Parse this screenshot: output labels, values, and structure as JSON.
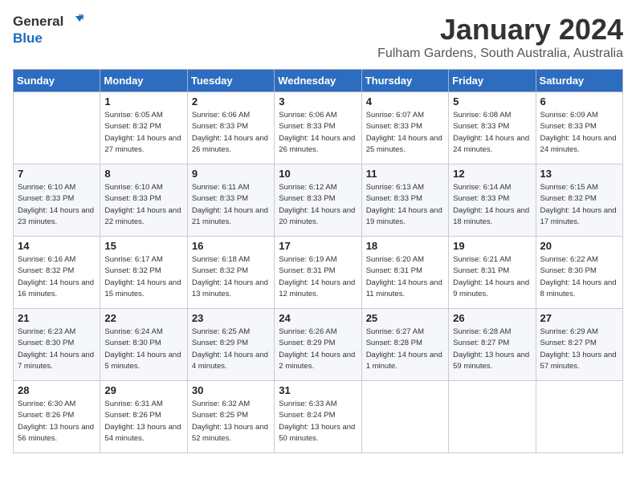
{
  "header": {
    "logo_general": "General",
    "logo_blue": "Blue",
    "month_title": "January 2024",
    "subtitle": "Fulham Gardens, South Australia, Australia"
  },
  "weekdays": [
    "Sunday",
    "Monday",
    "Tuesday",
    "Wednesday",
    "Thursday",
    "Friday",
    "Saturday"
  ],
  "weeks": [
    [
      {
        "day": "",
        "sunrise": "",
        "sunset": "",
        "daylight": ""
      },
      {
        "day": "1",
        "sunrise": "Sunrise: 6:05 AM",
        "sunset": "Sunset: 8:32 PM",
        "daylight": "Daylight: 14 hours and 27 minutes."
      },
      {
        "day": "2",
        "sunrise": "Sunrise: 6:06 AM",
        "sunset": "Sunset: 8:33 PM",
        "daylight": "Daylight: 14 hours and 26 minutes."
      },
      {
        "day": "3",
        "sunrise": "Sunrise: 6:06 AM",
        "sunset": "Sunset: 8:33 PM",
        "daylight": "Daylight: 14 hours and 26 minutes."
      },
      {
        "day": "4",
        "sunrise": "Sunrise: 6:07 AM",
        "sunset": "Sunset: 8:33 PM",
        "daylight": "Daylight: 14 hours and 25 minutes."
      },
      {
        "day": "5",
        "sunrise": "Sunrise: 6:08 AM",
        "sunset": "Sunset: 8:33 PM",
        "daylight": "Daylight: 14 hours and 24 minutes."
      },
      {
        "day": "6",
        "sunrise": "Sunrise: 6:09 AM",
        "sunset": "Sunset: 8:33 PM",
        "daylight": "Daylight: 14 hours and 24 minutes."
      }
    ],
    [
      {
        "day": "7",
        "sunrise": "Sunrise: 6:10 AM",
        "sunset": "Sunset: 8:33 PM",
        "daylight": "Daylight: 14 hours and 23 minutes."
      },
      {
        "day": "8",
        "sunrise": "Sunrise: 6:10 AM",
        "sunset": "Sunset: 8:33 PM",
        "daylight": "Daylight: 14 hours and 22 minutes."
      },
      {
        "day": "9",
        "sunrise": "Sunrise: 6:11 AM",
        "sunset": "Sunset: 8:33 PM",
        "daylight": "Daylight: 14 hours and 21 minutes."
      },
      {
        "day": "10",
        "sunrise": "Sunrise: 6:12 AM",
        "sunset": "Sunset: 8:33 PM",
        "daylight": "Daylight: 14 hours and 20 minutes."
      },
      {
        "day": "11",
        "sunrise": "Sunrise: 6:13 AM",
        "sunset": "Sunset: 8:33 PM",
        "daylight": "Daylight: 14 hours and 19 minutes."
      },
      {
        "day": "12",
        "sunrise": "Sunrise: 6:14 AM",
        "sunset": "Sunset: 8:33 PM",
        "daylight": "Daylight: 14 hours and 18 minutes."
      },
      {
        "day": "13",
        "sunrise": "Sunrise: 6:15 AM",
        "sunset": "Sunset: 8:32 PM",
        "daylight": "Daylight: 14 hours and 17 minutes."
      }
    ],
    [
      {
        "day": "14",
        "sunrise": "Sunrise: 6:16 AM",
        "sunset": "Sunset: 8:32 PM",
        "daylight": "Daylight: 14 hours and 16 minutes."
      },
      {
        "day": "15",
        "sunrise": "Sunrise: 6:17 AM",
        "sunset": "Sunset: 8:32 PM",
        "daylight": "Daylight: 14 hours and 15 minutes."
      },
      {
        "day": "16",
        "sunrise": "Sunrise: 6:18 AM",
        "sunset": "Sunset: 8:32 PM",
        "daylight": "Daylight: 14 hours and 13 minutes."
      },
      {
        "day": "17",
        "sunrise": "Sunrise: 6:19 AM",
        "sunset": "Sunset: 8:31 PM",
        "daylight": "Daylight: 14 hours and 12 minutes."
      },
      {
        "day": "18",
        "sunrise": "Sunrise: 6:20 AM",
        "sunset": "Sunset: 8:31 PM",
        "daylight": "Daylight: 14 hours and 11 minutes."
      },
      {
        "day": "19",
        "sunrise": "Sunrise: 6:21 AM",
        "sunset": "Sunset: 8:31 PM",
        "daylight": "Daylight: 14 hours and 9 minutes."
      },
      {
        "day": "20",
        "sunrise": "Sunrise: 6:22 AM",
        "sunset": "Sunset: 8:30 PM",
        "daylight": "Daylight: 14 hours and 8 minutes."
      }
    ],
    [
      {
        "day": "21",
        "sunrise": "Sunrise: 6:23 AM",
        "sunset": "Sunset: 8:30 PM",
        "daylight": "Daylight: 14 hours and 7 minutes."
      },
      {
        "day": "22",
        "sunrise": "Sunrise: 6:24 AM",
        "sunset": "Sunset: 8:30 PM",
        "daylight": "Daylight: 14 hours and 5 minutes."
      },
      {
        "day": "23",
        "sunrise": "Sunrise: 6:25 AM",
        "sunset": "Sunset: 8:29 PM",
        "daylight": "Daylight: 14 hours and 4 minutes."
      },
      {
        "day": "24",
        "sunrise": "Sunrise: 6:26 AM",
        "sunset": "Sunset: 8:29 PM",
        "daylight": "Daylight: 14 hours and 2 minutes."
      },
      {
        "day": "25",
        "sunrise": "Sunrise: 6:27 AM",
        "sunset": "Sunset: 8:28 PM",
        "daylight": "Daylight: 14 hours and 1 minute."
      },
      {
        "day": "26",
        "sunrise": "Sunrise: 6:28 AM",
        "sunset": "Sunset: 8:27 PM",
        "daylight": "Daylight: 13 hours and 59 minutes."
      },
      {
        "day": "27",
        "sunrise": "Sunrise: 6:29 AM",
        "sunset": "Sunset: 8:27 PM",
        "daylight": "Daylight: 13 hours and 57 minutes."
      }
    ],
    [
      {
        "day": "28",
        "sunrise": "Sunrise: 6:30 AM",
        "sunset": "Sunset: 8:26 PM",
        "daylight": "Daylight: 13 hours and 56 minutes."
      },
      {
        "day": "29",
        "sunrise": "Sunrise: 6:31 AM",
        "sunset": "Sunset: 8:26 PM",
        "daylight": "Daylight: 13 hours and 54 minutes."
      },
      {
        "day": "30",
        "sunrise": "Sunrise: 6:32 AM",
        "sunset": "Sunset: 8:25 PM",
        "daylight": "Daylight: 13 hours and 52 minutes."
      },
      {
        "day": "31",
        "sunrise": "Sunrise: 6:33 AM",
        "sunset": "Sunset: 8:24 PM",
        "daylight": "Daylight: 13 hours and 50 minutes."
      },
      {
        "day": "",
        "sunrise": "",
        "sunset": "",
        "daylight": ""
      },
      {
        "day": "",
        "sunrise": "",
        "sunset": "",
        "daylight": ""
      },
      {
        "day": "",
        "sunrise": "",
        "sunset": "",
        "daylight": ""
      }
    ]
  ]
}
